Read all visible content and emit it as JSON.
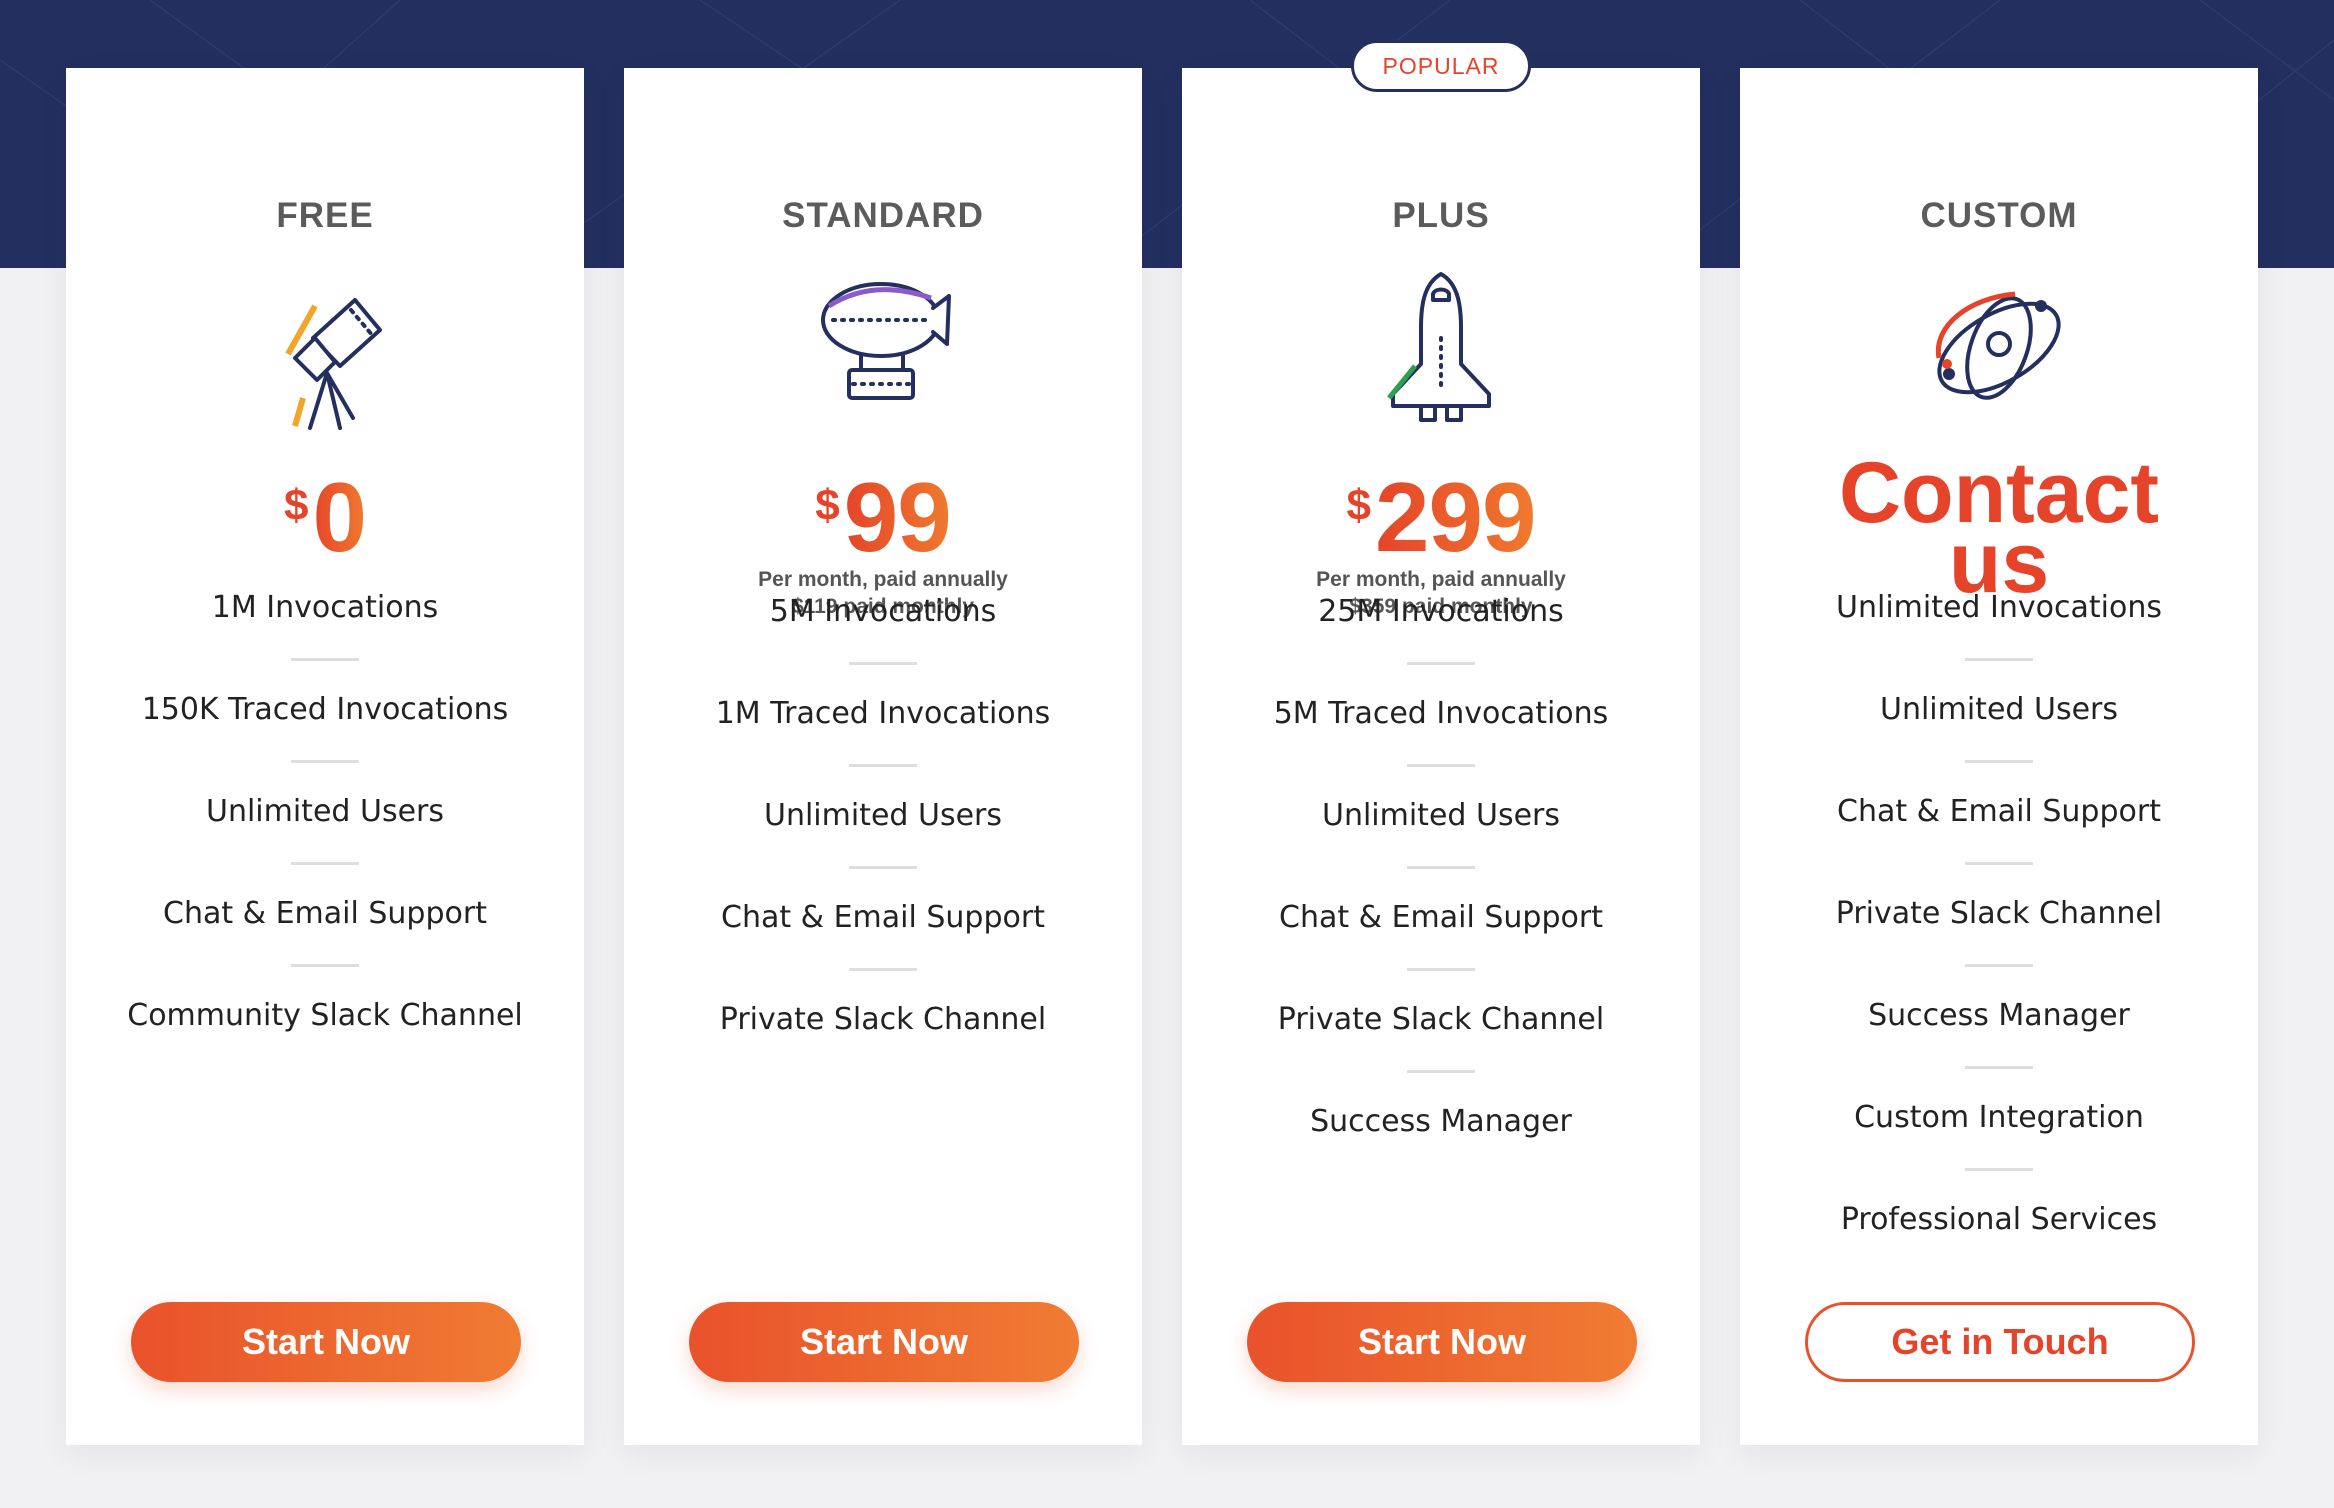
{
  "colors": {
    "navy": "#232f5f",
    "accent": "#e5442a",
    "accent_end": "#f07c33",
    "page_bg": "#f1f1f3",
    "card_bg": "#ffffff"
  },
  "popular_badge": "POPULAR",
  "plans": [
    {
      "name": "FREE",
      "icon": "telescope-icon",
      "currency": "$",
      "amount": "0",
      "features": [
        "1M Invocations",
        "150K Traced Invocations",
        "Unlimited Users",
        "Chat & Email Support",
        "Community Slack Channel"
      ],
      "cta": "Start Now"
    },
    {
      "name": "STANDARD",
      "icon": "airship-icon",
      "currency": "$",
      "amount": "99",
      "note_annual": "Per month, paid annually",
      "note_monthly": "$119 paid monthly",
      "features": [
        "5M Invocations",
        "1M Traced Invocations",
        "Unlimited Users",
        "Chat & Email Support",
        "Private Slack Channel"
      ],
      "cta": "Start Now"
    },
    {
      "name": "PLUS",
      "icon": "space-shuttle-icon",
      "currency": "$",
      "amount": "299",
      "note_annual": "Per month, paid annually",
      "note_monthly": "$359 paid monthly",
      "features": [
        "25M Invocations",
        "5M Traced Invocations",
        "Unlimited Users",
        "Chat & Email Support",
        "Private Slack Channel",
        "Success Manager"
      ],
      "cta": "Start Now"
    },
    {
      "name": "CUSTOM",
      "icon": "atom-icon",
      "contact_line1": "Contact",
      "contact_line2": "us",
      "features": [
        "Unlimited Invocations",
        "Unlimited Users",
        "Chat & Email Support",
        "Private Slack Channel",
        "Success Manager",
        "Custom Integration",
        "Professional Services"
      ],
      "cta": "Get in Touch"
    }
  ]
}
